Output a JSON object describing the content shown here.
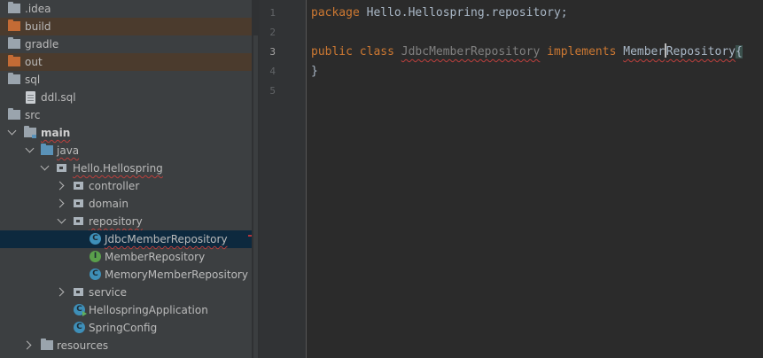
{
  "project_tree": {
    "items": [
      {
        "label": ".idea",
        "icon": "folder-icon"
      },
      {
        "label": "build",
        "icon": "folder-excluded-icon"
      },
      {
        "label": "gradle",
        "icon": "folder-icon"
      },
      {
        "label": "out",
        "icon": "folder-excluded-icon"
      },
      {
        "label": "sql",
        "icon": "folder-icon"
      },
      {
        "label": "ddl.sql",
        "icon": "sql-file-icon"
      },
      {
        "label": "src",
        "icon": "folder-icon"
      },
      {
        "label": "main",
        "icon": "source-folder-icon"
      },
      {
        "label": "java",
        "icon": "source-root-folder-icon"
      },
      {
        "label": "Hello.Hellospring",
        "icon": "package-icon"
      },
      {
        "label": "controller",
        "icon": "package-icon"
      },
      {
        "label": "domain",
        "icon": "package-icon"
      },
      {
        "label": "repository",
        "icon": "package-icon"
      },
      {
        "label": "JdbcMemberRepository",
        "icon": "java-class-icon"
      },
      {
        "label": "MemberRepository",
        "icon": "java-interface-icon"
      },
      {
        "label": "MemoryMemberRepository",
        "icon": "java-class-icon"
      },
      {
        "label": "service",
        "icon": "package-icon"
      },
      {
        "label": "HellospringApplication",
        "icon": "spring-boot-main-class-icon"
      },
      {
        "label": "SpringConfig",
        "icon": "java-class-icon"
      },
      {
        "label": "resources",
        "icon": "resources-folder-icon"
      }
    ]
  },
  "editor": {
    "line_numbers": [
      "1",
      "2",
      "3",
      "4",
      "5"
    ],
    "current_line": "3",
    "lines": {
      "l1": {
        "kw": "package",
        "rest": " Hello.Hellospring.repository;"
      },
      "l3": {
        "kw1": "public",
        "kw2": "class",
        "class_name": "JdbcMemberRepository",
        "kw3": "implements",
        "iface_before_caret": "Member",
        "iface_after_caret": "Repository",
        "brace": "{"
      },
      "l4": {
        "brace": "}"
      }
    }
  },
  "colors": {
    "tree_bg": "#3c3f41",
    "editor_bg": "#2b2b2b",
    "keyword": "#cc7832",
    "selection": "#0d293e",
    "excluded_folder": "#c36b35"
  }
}
